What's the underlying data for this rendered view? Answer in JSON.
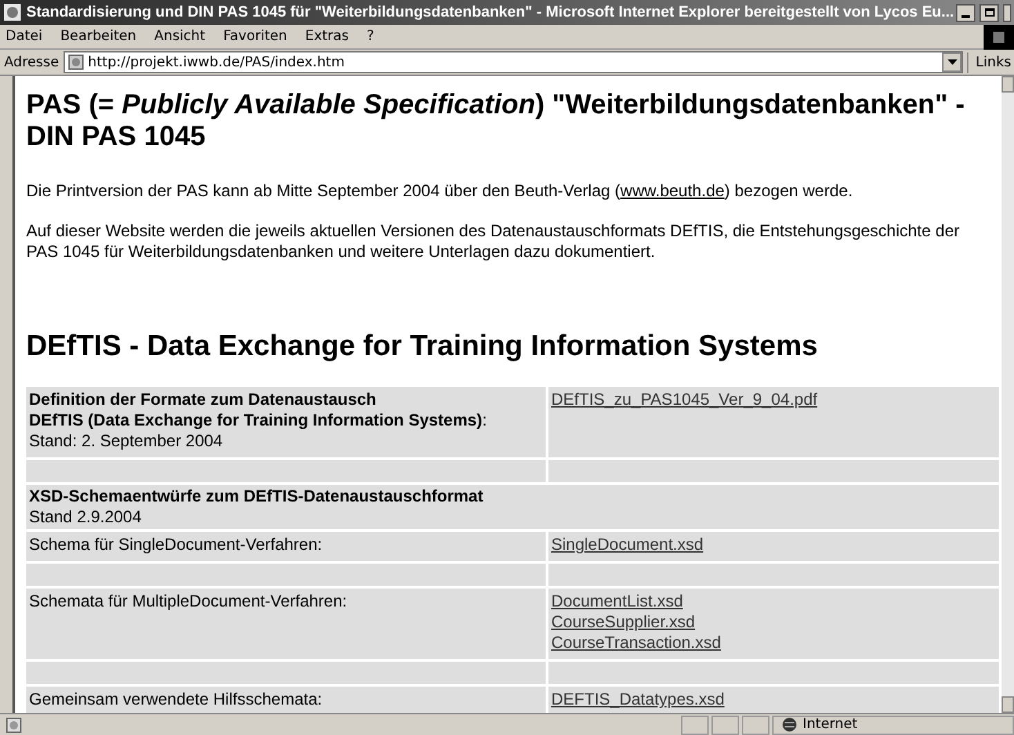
{
  "window": {
    "title": "Standardisierung und DIN PAS 1045 für \"Weiterbildungsdatenbanken\" - Microsoft Internet Explorer bereitgestellt von Lycos Eu..."
  },
  "menu": [
    "Datei",
    "Bearbeiten",
    "Ansicht",
    "Favoriten",
    "Extras",
    "?"
  ],
  "address": {
    "label": "Adresse",
    "url": "http://projekt.iwwb.de/PAS/index.htm",
    "links": "Links"
  },
  "page": {
    "heading": "PAS (= *Publicly Available Specification*) \"Weiterbildungsdatenbanken\" - DIN PAS 1045",
    "paragraphs": [
      {
        "before": "Die Printversion der PAS kann ab Mitte September 2004 über den Beuth-Verlag (",
        "link": "www.beuth.de",
        "after": ") bezogen werde."
      },
      {
        "before": "Auf dieser Website werden die jeweils aktuellen Versionen des Datenaustauschformats DEfTIS, die Entstehungsgeschichte der PAS 1045 für Weiterbildungsdatenbanken und weitere Unterlagen dazu dokumentiert."
      }
    ],
    "subheading": "DEfTIS - Data Exchange for Training Information Systems",
    "table": [
      {
        "kind": "entry",
        "lines": [
          "**Definition der Formate zum Datenaustausch**",
          "**DEfTIS (Data Exchange for Training Information Systems)**:",
          "Stand: 2. September 2004"
        ],
        "links": [
          "DEfTIS_zu_PAS1045_Ver_9_04.pdf"
        ]
      },
      {
        "kind": "spacer"
      },
      {
        "kind": "header",
        "lines": [
          "**XSD-Schemaentwürfe zum DEfTIS-Datenaustauschformat**",
          "Stand 2.9.2004"
        ]
      },
      {
        "kind": "entry",
        "lines": [
          "Schema für SingleDocument-Verfahren:"
        ],
        "links": [
          "SingleDocument.xsd"
        ]
      },
      {
        "kind": "spacer"
      },
      {
        "kind": "entry",
        "lines": [
          "Schemata für MultipleDocument-Verfahren:"
        ],
        "links": [
          "DocumentList.xsd",
          "CourseSupplier.xsd",
          "CourseTransaction.xsd"
        ]
      },
      {
        "kind": "spacer"
      },
      {
        "kind": "entry",
        "lines": [
          "Gemeinsam verwendete Hilfsschemata:"
        ],
        "links": [
          "DEFTIS_Datatypes.xsd"
        ]
      }
    ]
  },
  "status_bar": {
    "zone": "Internet"
  }
}
